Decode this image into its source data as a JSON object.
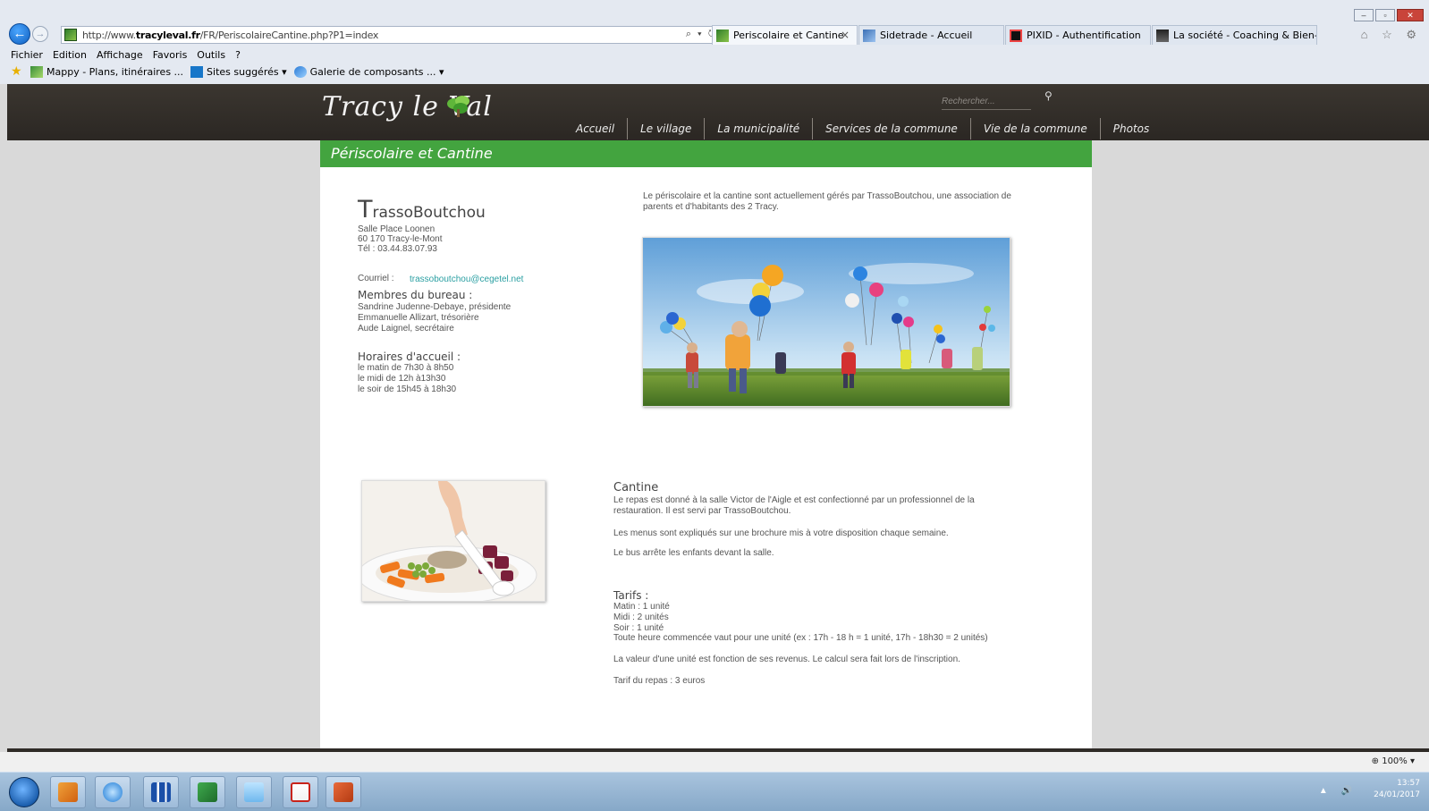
{
  "browser": {
    "url_prefix": "http://www.",
    "url_host": "tracyleval.fr",
    "url_path": "/FR/PeriscolaireCantine.php?P1=index",
    "address_icons": "⌕ ▾ ↻",
    "tabs": [
      {
        "label": "Periscolaire et Cantine",
        "close": "×",
        "active": true
      },
      {
        "label": "Sidetrade - Accueil",
        "active": false
      },
      {
        "label": "PIXID - Authentification",
        "active": false
      },
      {
        "label": "La société - Coaching & Bien-...",
        "active": false
      }
    ],
    "menu": [
      "Fichier",
      "Edition",
      "Affichage",
      "Favoris",
      "Outils",
      "?"
    ],
    "favorites": [
      {
        "label": "Mappy - Plans, itinéraires ..."
      },
      {
        "label": "Sites suggérés ▾"
      },
      {
        "label": "Galerie de composants ... ▾"
      }
    ],
    "right_icons": "⌂ ☆ ⚙",
    "window_controls": {
      "minimize": "–",
      "maximize": "▫",
      "close": "✕"
    }
  },
  "site": {
    "logo_text": "Tracy le Val",
    "search_placeholder": "Rechercher...",
    "nav": [
      "Accueil",
      "Le village",
      "La municipalité",
      "Services de la commune",
      "Vie de la commune",
      "Photos"
    ],
    "colors": {
      "header_bg": "#2f2b27",
      "title_bar": "#43a43f",
      "link": "#2a9fa2"
    }
  },
  "page": {
    "title": "Périscolaire et Cantine",
    "org_initial": "T",
    "org_rest": "rassoBoutchou",
    "address_lines": [
      "Salle Place Loonen",
      "60 170 Tracy-le-Mont",
      "Tél : 03.44.83.07.93"
    ],
    "courriel_label": "Courriel :",
    "courriel_value": "trassoboutchou@cegetel.net",
    "bureau_title": "Membres du bureau :",
    "bureau_lines": [
      "Sandrine Judenne-Debaye, présidente",
      "Emmanuelle Allizart, trésorière",
      "Aude Laignel, secrétaire"
    ],
    "horaires_title": "Horaires d'accueil :",
    "horaires_lines": [
      "le matin de 7h30 à 8h50",
      "le midi de 12h à13h30",
      "le soir de 15h45 à 18h30"
    ],
    "intro_lines": [
      "Le périscolaire et la cantine sont actuellement gérés par TrassoBoutchou, une association de",
      "parents et d'habitants des 2 Tracy."
    ],
    "cantine_title": "Cantine",
    "cantine_p1_lines": [
      "Le repas est donné à la salle Victor de l'Aigle et est confectionné par un professionnel de la",
      "restauration. Il est servi par TrassoBoutchou."
    ],
    "cantine_p2": "Les menus sont expliqués sur une brochure mis à votre disposition chaque semaine.",
    "cantine_p3": "Le bus arrête les enfants devant la salle.",
    "tarifs_title": "Tarifs :",
    "tarifs_lines": [
      "Matin : 1 unité",
      "Midi : 2 unités",
      "Soir : 1 unité",
      "Toute heure commencée vaut pour une unité (ex : 17h - 18 h = 1 unité, 17h - 18h30 = 2 unités)"
    ],
    "tarifs_p2": "La valeur d'une unité est fonction de ses revenus. Le calcul sera fait lors de l'inscription.",
    "tarifs_p3": "Tarif du repas : 3 euros"
  },
  "status": {
    "zoom": "100%"
  },
  "taskbar": {
    "apps": [
      "outlook-icon",
      "internet-explorer-icon",
      "remote-desktop-icon",
      "excel-icon",
      "notepad-icon",
      "pdf-icon",
      "powerpoint-icon"
    ],
    "time": "13:57",
    "date": "24/01/2017",
    "tray": "▲ 🔊"
  }
}
